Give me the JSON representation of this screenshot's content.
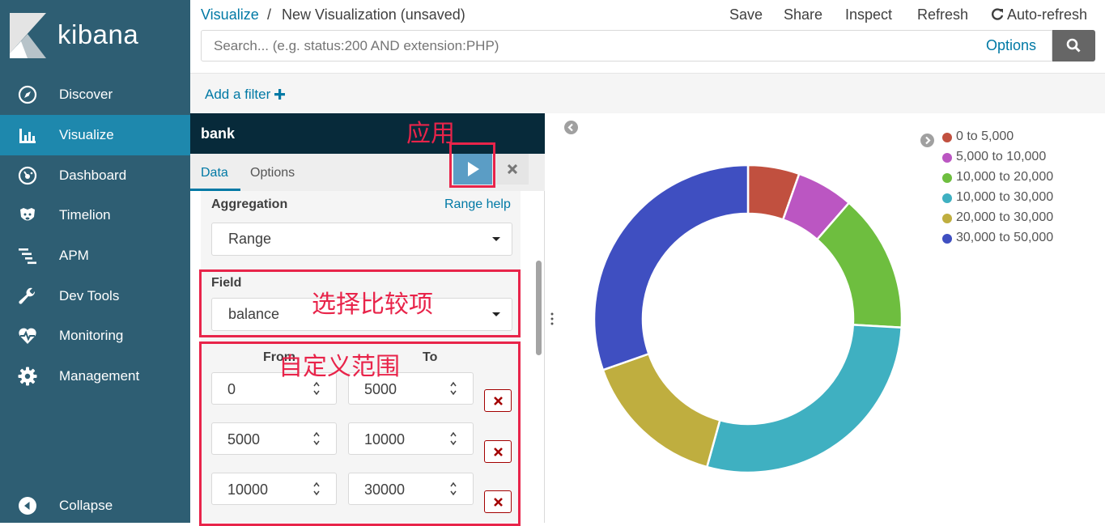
{
  "sidebar": {
    "brand": "kibana",
    "items": [
      {
        "label": "Discover",
        "icon": "compass-icon"
      },
      {
        "label": "Visualize",
        "icon": "bar-chart-icon",
        "active": true
      },
      {
        "label": "Dashboard",
        "icon": "dashboard-gauge-icon"
      },
      {
        "label": "Timelion",
        "icon": "timelion-icon"
      },
      {
        "label": "APM",
        "icon": "apm-icon"
      },
      {
        "label": "Dev Tools",
        "icon": "wrench-icon"
      },
      {
        "label": "Monitoring",
        "icon": "heartbeat-icon"
      },
      {
        "label": "Management",
        "icon": "gear-icon"
      }
    ],
    "collapse_label": "Collapse"
  },
  "breadcrumb": {
    "root": "Visualize",
    "separator": "/",
    "current": "New Visualization (unsaved)"
  },
  "top_actions": {
    "save": "Save",
    "share": "Share",
    "inspect": "Inspect",
    "refresh": "Refresh",
    "auto_refresh": "Auto-refresh"
  },
  "search": {
    "placeholder": "Search... (e.g. status:200 AND extension:PHP)",
    "options_label": "Options"
  },
  "filter_bar": {
    "add_filter_label": "Add a filter"
  },
  "editor": {
    "index_pattern": "bank",
    "tabs": [
      "Data",
      "Options"
    ],
    "aggregation_label": "Aggregation",
    "range_help": "Range help",
    "aggregation_value": "Range",
    "field_label": "Field",
    "field_value": "balance",
    "from_label": "From",
    "to_label": "To",
    "ranges": [
      {
        "from": "0",
        "to": "5000"
      },
      {
        "from": "5000",
        "to": "10000"
      },
      {
        "from": "10000",
        "to": "30000"
      }
    ]
  },
  "annotations": {
    "apply": "应用",
    "field": "选择比较项",
    "range": "自定义范围"
  },
  "colors": {
    "sidebar_bg": "#2e5e73",
    "active_nav": "#1e88ad",
    "link": "#0079a5",
    "annotation": "#e8244a"
  },
  "chart_data": {
    "type": "pie",
    "donut": true,
    "legend_position": "top-right",
    "categories": [
      "0 to 5,000",
      "5,000 to 10,000",
      "10,000 to 20,000",
      "10,000 to 30,000",
      "20,000 to 30,000",
      "30,000 to 50,000"
    ],
    "values": [
      5.4,
      6.0,
      14.5,
      28.4,
      15.3,
      30.4
    ],
    "colors": [
      "#c1503f",
      "#bb56c2",
      "#6ebe3f",
      "#3fb0c1",
      "#bfae3f",
      "#3f4fc1"
    ]
  }
}
